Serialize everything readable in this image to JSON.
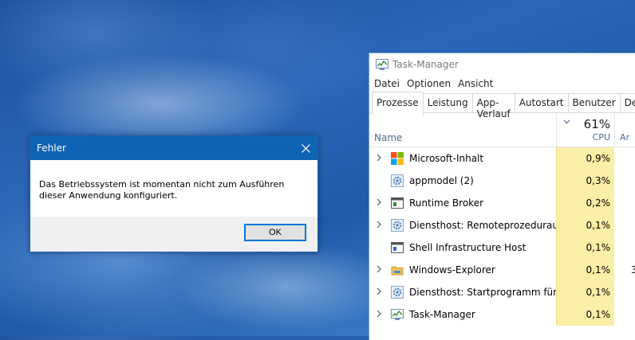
{
  "error_dialog": {
    "title": "Fehler",
    "message": "Das Betriebssystem ist momentan nicht zum Ausführen dieser Anwendung konfiguriert.",
    "ok_label": "OK",
    "titlebar_color": "#0f63b4"
  },
  "task_manager": {
    "title": "Task-Manager",
    "menu": [
      "Datei",
      "Optionen",
      "Ansicht"
    ],
    "tabs": [
      "Prozesse",
      "Leistung",
      "App-Verlauf",
      "Autostart",
      "Benutzer",
      "Det"
    ],
    "active_tab": "Prozesse",
    "columns": {
      "name": "Name",
      "cpu_total": "61%",
      "cpu": "CPU",
      "next": "Ar"
    },
    "processes": [
      {
        "name": "Microsoft-Inhalt",
        "cpu": "0,9%",
        "expandable": true,
        "icon": "windows-logo-icon",
        "extra": ""
      },
      {
        "name": "appmodel (2)",
        "cpu": "0,3%",
        "expandable": false,
        "icon": "gear-service-icon",
        "extra": ""
      },
      {
        "name": "Runtime Broker",
        "cpu": "0,2%",
        "expandable": true,
        "icon": "app-window-icon",
        "extra": ""
      },
      {
        "name": "Diensthost: Remoteprozeduraufruf...",
        "cpu": "0,1%",
        "expandable": true,
        "icon": "gear-service-icon",
        "extra": ""
      },
      {
        "name": "Shell Infrastructure Host",
        "cpu": "0,1%",
        "expandable": false,
        "icon": "app-window-icon",
        "extra": ""
      },
      {
        "name": "Windows-Explorer",
        "cpu": "0,1%",
        "expandable": true,
        "icon": "folder-icon",
        "extra": "3"
      },
      {
        "name": "Diensthost: Startprogramm für ...",
        "cpu": "0,1%",
        "expandable": true,
        "icon": "gear-service-icon",
        "extra": ""
      },
      {
        "name": "Task-Manager",
        "cpu": "0,1%",
        "expandable": true,
        "icon": "task-manager-icon",
        "extra": ""
      }
    ],
    "cpu_highlight_color": "#fbeea6"
  }
}
